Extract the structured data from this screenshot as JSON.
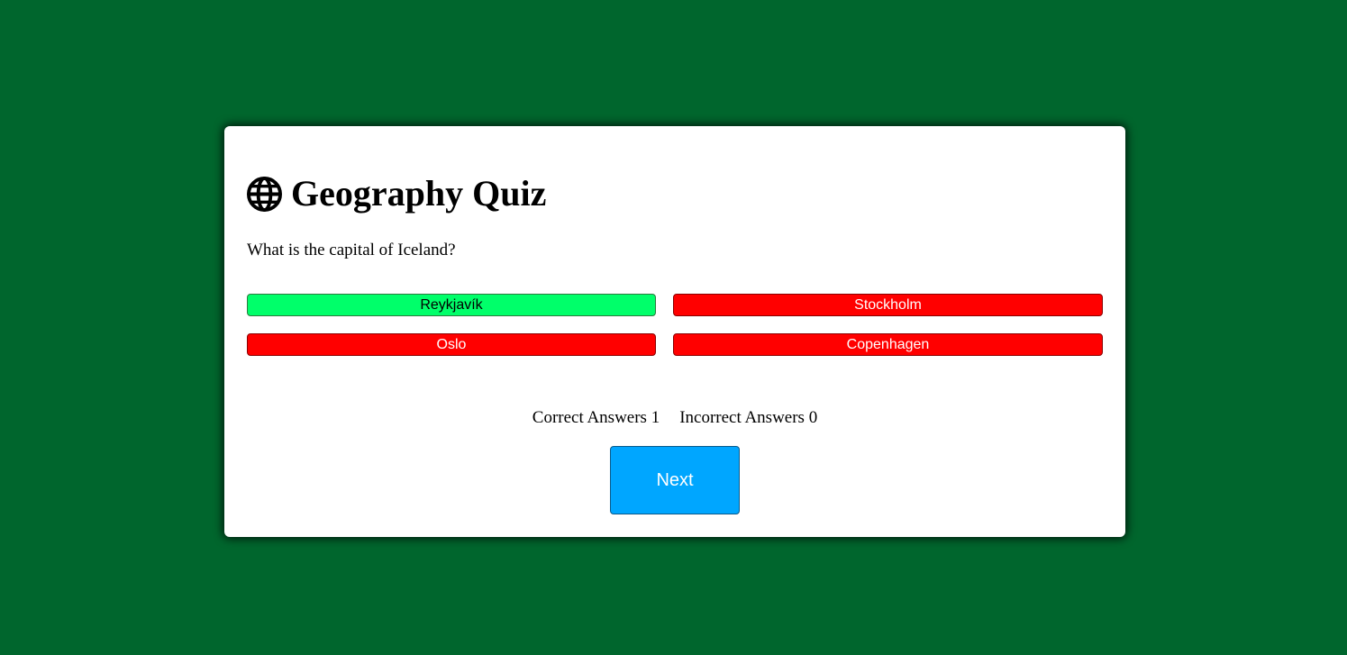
{
  "quiz": {
    "title": "Geography Quiz",
    "title_icon": "globe-icon",
    "question": "What is the capital of Iceland?",
    "answers": [
      {
        "label": "Reykjavík",
        "state": "correct"
      },
      {
        "label": "Stockholm",
        "state": "incorrect"
      },
      {
        "label": "Oslo",
        "state": "incorrect"
      },
      {
        "label": "Copenhagen",
        "state": "incorrect"
      }
    ],
    "score": {
      "correct_label": "Correct Answers",
      "correct_count": "1",
      "incorrect_label": "Incorrect Answers",
      "incorrect_count": "0"
    },
    "next_label": "Next"
  },
  "colors": {
    "background": "#00662d",
    "correct": "#00ff6a",
    "incorrect": "#ff0000",
    "next_button": "#00a6ff"
  }
}
